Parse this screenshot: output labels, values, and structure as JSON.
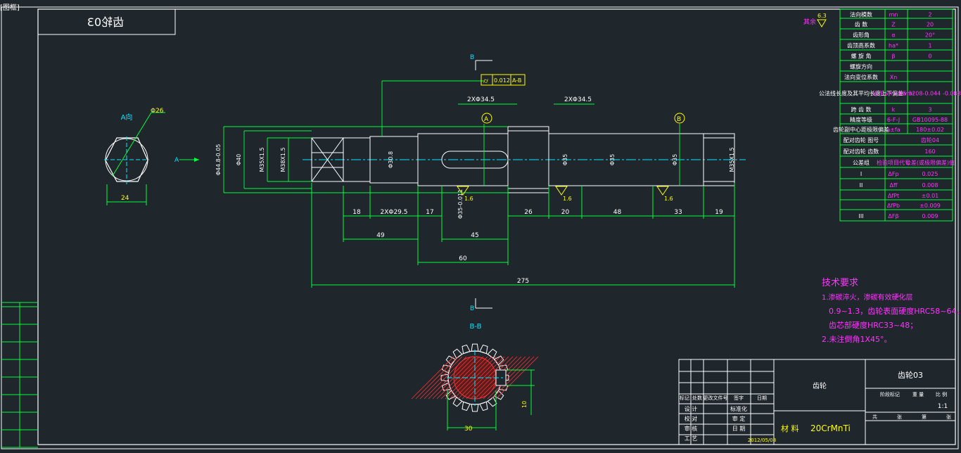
{
  "window": {
    "corner_tab": "[图框]"
  },
  "drawing": {
    "title_block_mirrored": "齿轮03",
    "view_section_label": "B-B",
    "view_arrow_a": "A",
    "view_a_label": "A向",
    "cut_label_b": "B",
    "surface_note": "其余",
    "surface_roughness": "6.3",
    "datum_a": "A",
    "datum_b": "B",
    "tolerance_frame": {
      "symbol": "⌭",
      "value": "0.012",
      "datums": "A-B"
    },
    "roughness_values": [
      "1.6",
      "1.6",
      "1.6"
    ],
    "dims_top": [
      "2XΦ34.5",
      "2XΦ34.5"
    ],
    "dims_vertical": [
      "Φ44.8-0.05",
      "Φ40",
      "M35X1.5",
      "M38X1.5",
      "Φ30.8",
      "Φ35",
      "Φ35",
      "Φ35",
      "M35X1.5",
      "Φ35-0.011"
    ],
    "dims_bottom_row1": [
      "18",
      "2XΦ29.5",
      "17",
      "26",
      "20",
      "48",
      "33",
      "19"
    ],
    "dims_row2": [
      "49",
      "45"
    ],
    "dims_row3": [
      "60"
    ],
    "dims_total": [
      "275"
    ],
    "hex_dims": [
      "Φ26",
      "24"
    ],
    "section_dims": [
      "30",
      "10"
    ],
    "tech_req": {
      "title": "技术要求",
      "lines": [
        "1.渗碳淬火，渗碳有效硬化层",
        "0.9~1.3，齿轮表面硬度HRC58~64，",
        "齿芯部硬度HRC33~48；",
        "2.未注倒角1X45°。"
      ]
    }
  },
  "gear_params": {
    "rows": [
      [
        "法向模数",
        "mn",
        "2"
      ],
      [
        "齿 数",
        "Z",
        "20"
      ],
      [
        "齿形角",
        "α",
        "20°"
      ],
      [
        "齿顶高系数",
        "ha*",
        "1"
      ],
      [
        "螺 旋 角",
        "β",
        "0"
      ],
      [
        "螺旋方向",
        "",
        ""
      ],
      [
        "法向变位系数",
        "Xn",
        ""
      ],
      [
        "公法线长度及其平均长度上下偏差",
        "W Ewms Ewmi",
        "15.3208-0.044 -0.088"
      ],
      [
        "跨 齿 数",
        "k",
        "3"
      ],
      [
        "精度等级",
        "6-F-J",
        "GB10095-88"
      ],
      [
        "齿轮副中心距极限偏差",
        "a±fa",
        "180±0.02"
      ],
      [
        "配对齿轮 图号",
        "",
        "齿轮04"
      ],
      [
        "配对齿轮 齿数",
        "",
        "160"
      ],
      [
        "公差组",
        "检验项目代号",
        "公差(或极限偏差)值"
      ],
      [
        "I",
        "ΔFp",
        "0.025"
      ],
      [
        "II",
        "Δff",
        "0.008"
      ],
      [
        "",
        "ΔfPt",
        "±0.01"
      ],
      [
        "",
        "ΔfPb",
        "±0.009"
      ],
      [
        "III",
        "ΔFβ",
        "0.009"
      ]
    ]
  },
  "title_block": {
    "part_name": "齿轮",
    "drawing_no": "齿轮03",
    "material_label": "材 料",
    "material": "20CrMnTi",
    "scale_label": "比 例",
    "scale": "1:1",
    "weight_label": "重 量",
    "stage_label": "阶段标记",
    "headers": [
      "标记",
      "处数",
      "更改文件号",
      "签字",
      "日期"
    ],
    "roles": [
      "设 计",
      "校 对",
      "审 核",
      "工 艺"
    ],
    "roles2": [
      "标准化",
      "审 定",
      "日 期"
    ],
    "date": "2012/05/08",
    "sheet": [
      "共",
      "张",
      "第",
      "张"
    ]
  },
  "left_strip": [
    "",
    "",
    "",
    "",
    "",
    "",
    "",
    ""
  ],
  "colors": {
    "bg": "#1f262c",
    "line": "#ffffff",
    "green": "#00ff3c",
    "cyan": "#00e6ff",
    "magenta": "#ff35ff",
    "yellow": "#ffff00",
    "red": "#ff3030"
  }
}
